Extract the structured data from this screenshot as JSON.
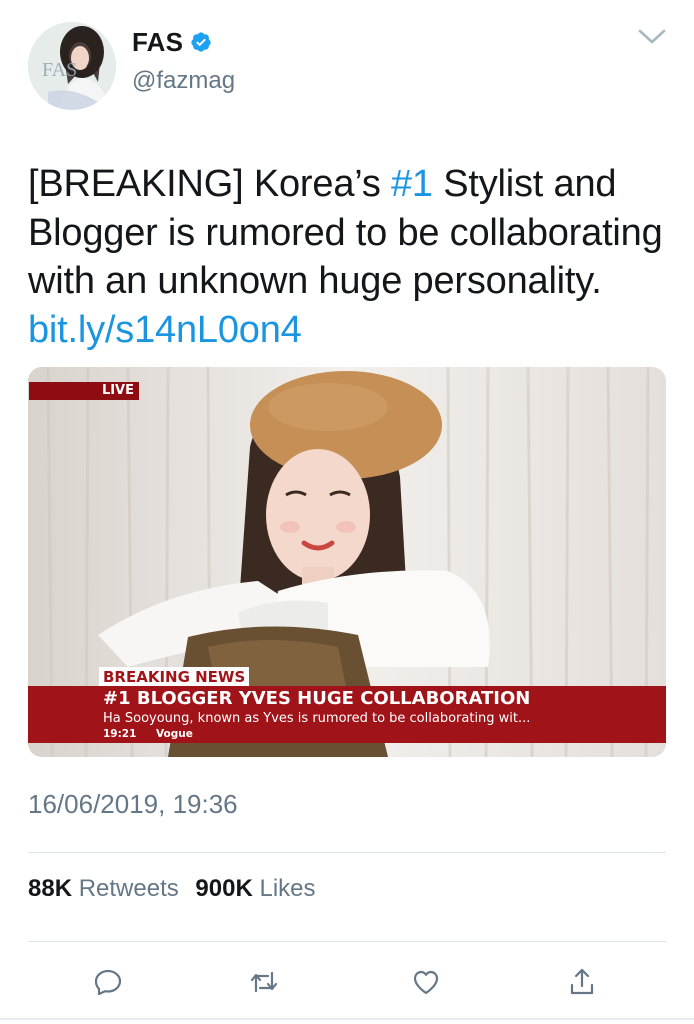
{
  "user": {
    "display_name": "FAS",
    "handle": "@fazmag",
    "avatar_text": "FAS",
    "verified": true
  },
  "tweet": {
    "text_parts": [
      "[BREAKING] Korea’s ",
      "#1",
      " Stylist and Blogger is rumored to be collaborating with an unknown huge personality. ",
      "bit.ly/s14nL0on4"
    ]
  },
  "media": {
    "live_label": "LIVE",
    "breaking_label": "BREAKING NEWS",
    "headline": "#1 BLOGGER YVES HUGE COLLABORATION",
    "subline": "Ha Sooyoung, known as Yves is rumored to be collaborating wit...",
    "time": "19:21",
    "source": "Vogue"
  },
  "timestamp": "16/06/2019, 19:36",
  "stats": {
    "retweets_count": "88K",
    "retweets_label": "Retweets",
    "likes_count": "900K",
    "likes_label": "Likes"
  },
  "icons": {
    "reply": "reply-icon",
    "retweet": "retweet-icon",
    "like": "heart-icon",
    "share": "share-icon",
    "more": "chevron-down-icon",
    "verified": "verified-badge-icon"
  },
  "colors": {
    "link": "#1b95e0",
    "verified": "#1da1f2",
    "muted": "#657786",
    "news_red": "#a01419"
  }
}
